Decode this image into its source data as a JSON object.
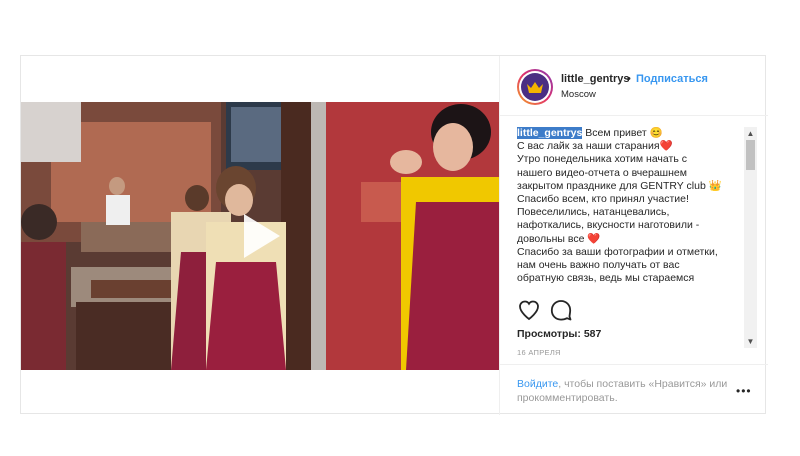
{
  "post": {
    "username": "little_gentrys",
    "separator": "•",
    "follow_label": "Подписаться",
    "location": "Moscow",
    "caption": {
      "username": "little_gentrys",
      "lines": [
        " Всем привет 😊",
        "С вас лайк за наши старания❤️",
        "Утро понедельника хотим начать с",
        "нашего видео-отчета о вчерашнем",
        "закрытом празднике для GENTRY club 👑",
        "Спасибо всем, кто принял участие!",
        "Повеселились, натанцевались,",
        "нафоткались, вкусности наготовили -",
        "довольны все ❤️",
        "Спасибо за ваши фотографии и отметки,",
        "нам очень важно получать от вас",
        "обратную связь, ведь мы стараемся"
      ]
    },
    "views_label": "Просмотры:",
    "views_count": "587",
    "date": "16 АПРЕЛЯ"
  },
  "footer": {
    "login_link": "Войдите",
    "login_text": ", чтобы поставить «Нравится» или прокомментировать.",
    "more_label": "•••"
  },
  "scrollbar": {
    "up": "▲",
    "down": "▼"
  },
  "colors": {
    "link": "#3897f0",
    "text": "#262626",
    "muted": "#999999",
    "highlight": "#3d7cc9"
  },
  "icons": {
    "like": "heart-icon",
    "comment": "comment-icon",
    "play": "play-icon",
    "avatar": "crown-icon"
  }
}
